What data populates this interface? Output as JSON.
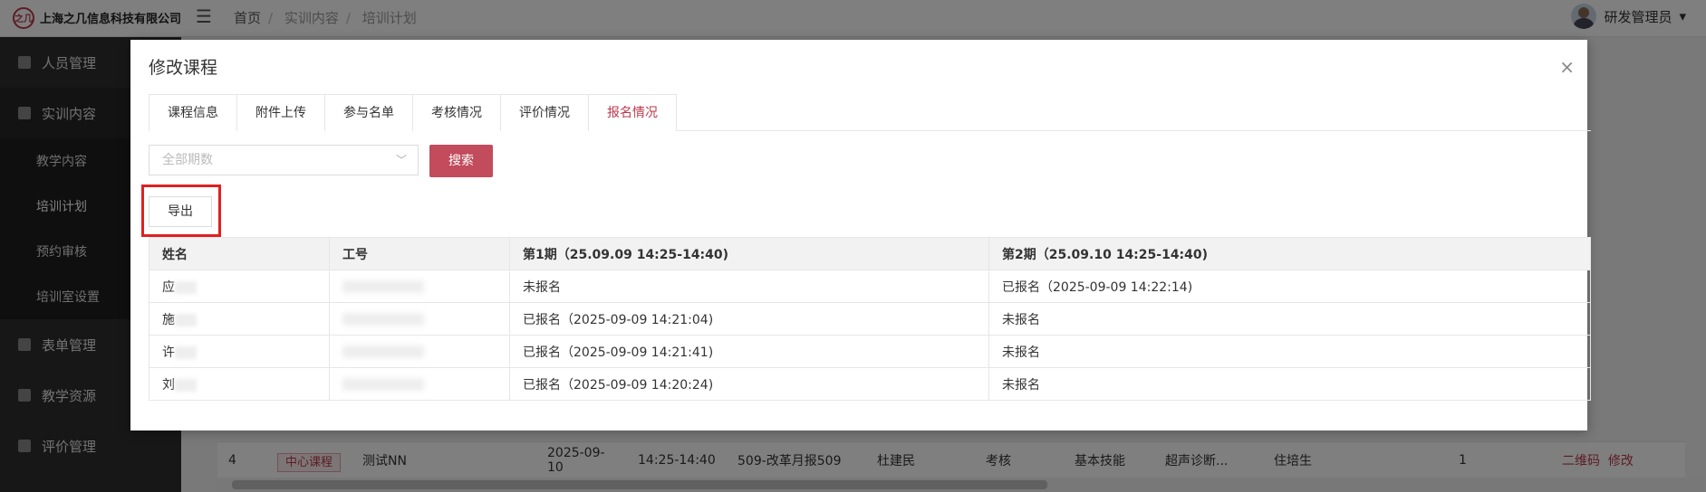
{
  "header": {
    "logo_text": "之几",
    "company": "上海之几信息科技有限公司",
    "breadcrumb": [
      "首页",
      "实训内容",
      "培训计划"
    ],
    "user_name": "研发管理员"
  },
  "sidebar": {
    "items": [
      {
        "label": "人员管理"
      },
      {
        "label": "实训内容"
      },
      {
        "label": "教学内容"
      },
      {
        "label": "培训计划"
      },
      {
        "label": "预约审核"
      },
      {
        "label": "培训室设置"
      },
      {
        "label": "表单管理"
      },
      {
        "label": "教学资源"
      },
      {
        "label": "评价管理"
      }
    ]
  },
  "background_row": {
    "index": "4",
    "tag": "中心课程",
    "name": "测试NN",
    "date": "2025-09-10",
    "time": "14:25-14:40",
    "room": "509-改革月报509",
    "teacher": "杜建民",
    "kind": "考核",
    "skill": "基本技能",
    "item": "超声诊断...",
    "target": "住培生",
    "count": "1",
    "link_qr": "二维码",
    "link_edit": "修改"
  },
  "modal": {
    "title": "修改课程",
    "close": "×",
    "tabs": [
      "课程信息",
      "附件上传",
      "参与名单",
      "考核情况",
      "评价情况",
      "报名情况"
    ],
    "active_tab": 5,
    "select_placeholder": "全部期数",
    "search_label": "搜索",
    "export_label": "导出",
    "table": {
      "headers": [
        "姓名",
        "工号",
        "第1期（25.09.09 14:25-14:40)",
        "第2期（25.09.10 14:25-14:40)"
      ],
      "rows": [
        [
          "应",
          "",
          "未报名",
          "已报名（2025-09-09 14:22:14)"
        ],
        [
          "施",
          "",
          "已报名（2025-09-09 14:21:04)",
          "未报名"
        ],
        [
          "许",
          "",
          "已报名（2025-09-09 14:21:41)",
          "未报名"
        ],
        [
          "刘",
          "",
          "已报名（2025-09-09 14:20:24)",
          "未报名"
        ]
      ]
    }
  },
  "colors": {
    "accent": "#b8394a",
    "button": "#c24b5c",
    "sidebar": "#2f2f2f",
    "highlight": "#e02020"
  }
}
